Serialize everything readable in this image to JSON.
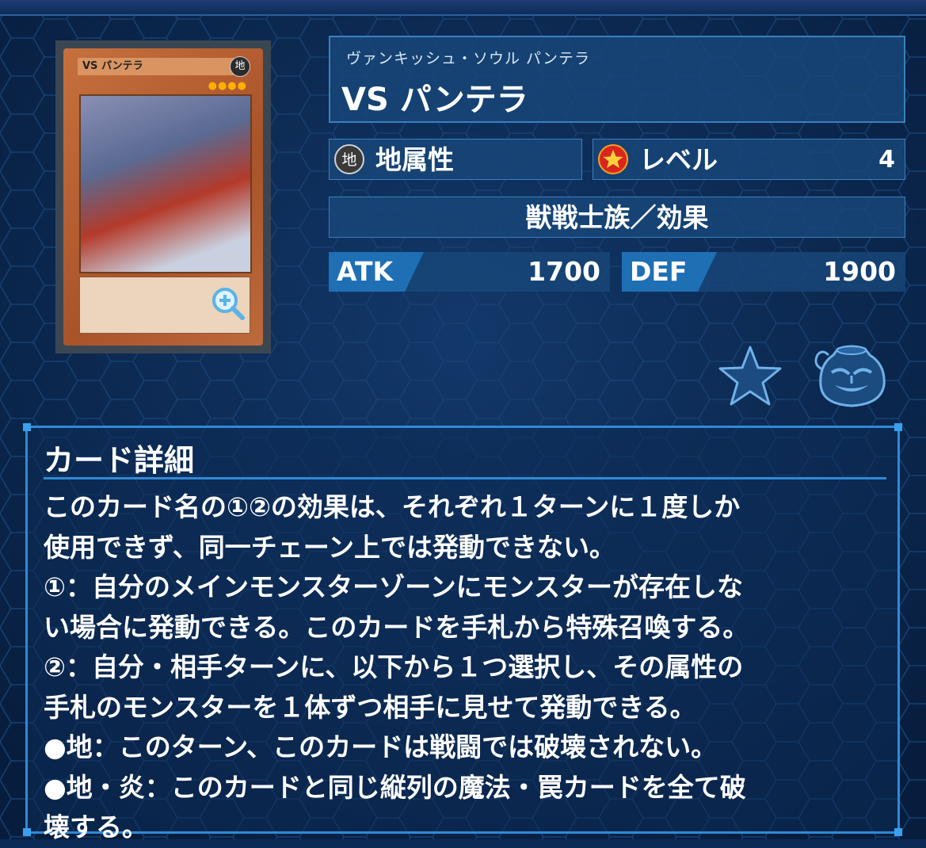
{
  "card": {
    "ruby": "ヴァンキッシュ・ソウル パンテラ",
    "name": "VS パンテラ",
    "thumb_name": "VS パンテラ",
    "thumb_attr": "地",
    "thumb_stars": "●●●●",
    "attribute_label": "地属性",
    "attribute_icon_text": "地",
    "level_label": "レベル",
    "level_value": "4",
    "type": "獣戦士族／効果",
    "atk_label": "ATK",
    "atk_value": "1700",
    "def_label": "DEF",
    "def_value": "1900"
  },
  "detail": {
    "title": "カード詳細",
    "text": "このカード名の①②の効果は、それぞれ１ターンに１度しか\n使用できず、同一チェーン上では発動できない。\n①：自分のメインモンスターゾーンにモンスターが存在しな\nい場合に発動できる。このカードを手札から特殊召喚する。\n②：自分・相手ターンに、以下から１つ選択し、その属性の\n手札のモンスターを１体ずつ相手に見せて発動できる。\n●地：このターン、このカードは戦闘では破壊されない。\n●地・炎：このカードと同じ縦列の魔法・罠カードを全て破\n壊する。"
  },
  "icons": {
    "zoom": "zoom-in-icon",
    "favorite": "star-icon",
    "deck": "pot-of-greed-icon",
    "attribute": "earth-attribute-icon",
    "level": "level-star-icon"
  },
  "colors": {
    "background": "#0b2a55",
    "panel": "#184678",
    "accent": "#2f8ad6",
    "stat_tab": "#1f6fb5"
  }
}
